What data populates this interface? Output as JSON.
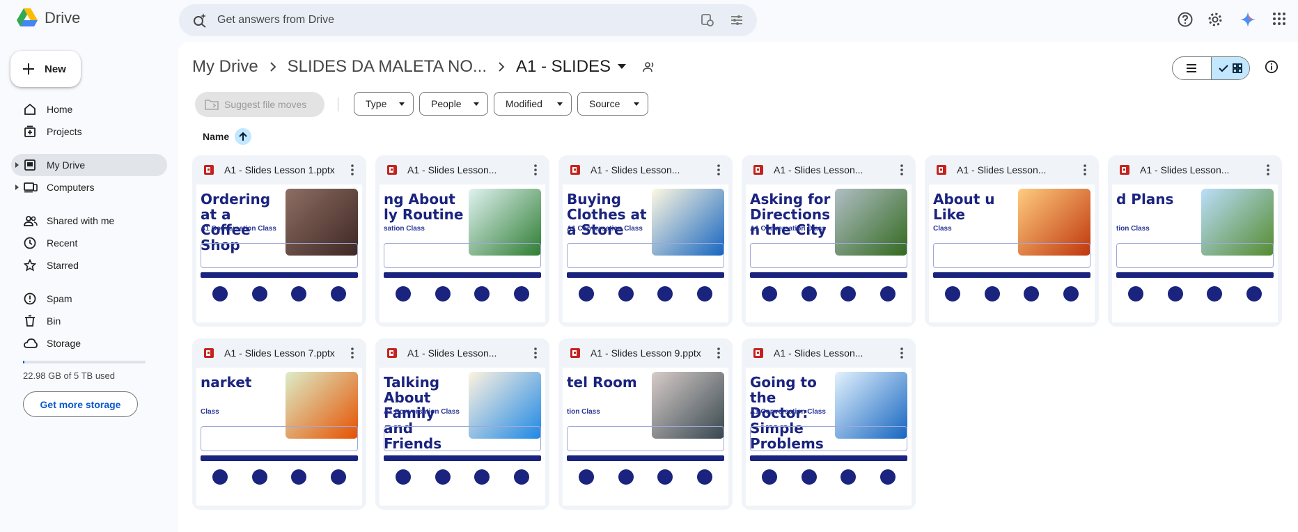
{
  "app": {
    "name": "Drive"
  },
  "search": {
    "placeholder": "Get answers from Drive"
  },
  "sidebar": {
    "new_label": "New",
    "items": [
      {
        "label": "Home"
      },
      {
        "label": "Projects"
      },
      {
        "label": "My Drive"
      },
      {
        "label": "Computers"
      },
      {
        "label": "Shared with me"
      },
      {
        "label": "Recent"
      },
      {
        "label": "Starred"
      },
      {
        "label": "Spam"
      },
      {
        "label": "Bin"
      },
      {
        "label": "Storage"
      }
    ],
    "storage_text": "22.98 GB of 5 TB used",
    "storage_fraction": 0.0046,
    "storage_button": "Get more storage"
  },
  "breadcrumb": {
    "root": "My Drive",
    "middle": "SLIDES DA MALETA NO...",
    "current": "A1 - SLIDES"
  },
  "toolbar": {
    "suggest_label": "Suggest file moves",
    "filters": [
      "Type",
      "People",
      "Modified",
      "Source"
    ]
  },
  "sort": {
    "label": "Name"
  },
  "files": [
    {
      "name": "A1 - Slides Lesson 1.pptx",
      "thumb_title": "Ordering at a Coffee Shop",
      "thumb_sub": "A1 Conversation Class"
    },
    {
      "name": "A1 - Slides Lesson...",
      "thumb_title": "ng About ly Routine",
      "thumb_sub": "sation Class"
    },
    {
      "name": "A1 - Slides Lesson...",
      "thumb_title": "Buying Clothes at a Store",
      "thumb_sub": "A1 Conversation Class"
    },
    {
      "name": "A1 - Slides Lesson...",
      "thumb_title": "Asking for Directions n the City",
      "thumb_sub": "A1 Conversation Class"
    },
    {
      "name": "A1 - Slides Lesson...",
      "thumb_title": "About u Like",
      "thumb_sub": "Class"
    },
    {
      "name": "A1 - Slides Lesson...",
      "thumb_title": "d Plans",
      "thumb_sub": "tion Class"
    },
    {
      "name": "A1 - Slides Lesson 7.pptx",
      "thumb_title": "narket",
      "thumb_sub": "Class"
    },
    {
      "name": "A1 - Slides Lesson...",
      "thumb_title": "Talking About Family and Friends",
      "thumb_sub": "A1 Conversation Class"
    },
    {
      "name": "A1 - Slides Lesson 9.pptx",
      "thumb_title": "tel Room",
      "thumb_sub": "tion Class"
    },
    {
      "name": "A1 - Slides Lesson...",
      "thumb_title": "Going to the Doctor: Simple Problems",
      "thumb_sub": "A1 Conversation Class"
    }
  ],
  "colors": {
    "accent": "#0b57d0",
    "selected": "#c2e7ff",
    "ppt_red": "#c5221f"
  }
}
